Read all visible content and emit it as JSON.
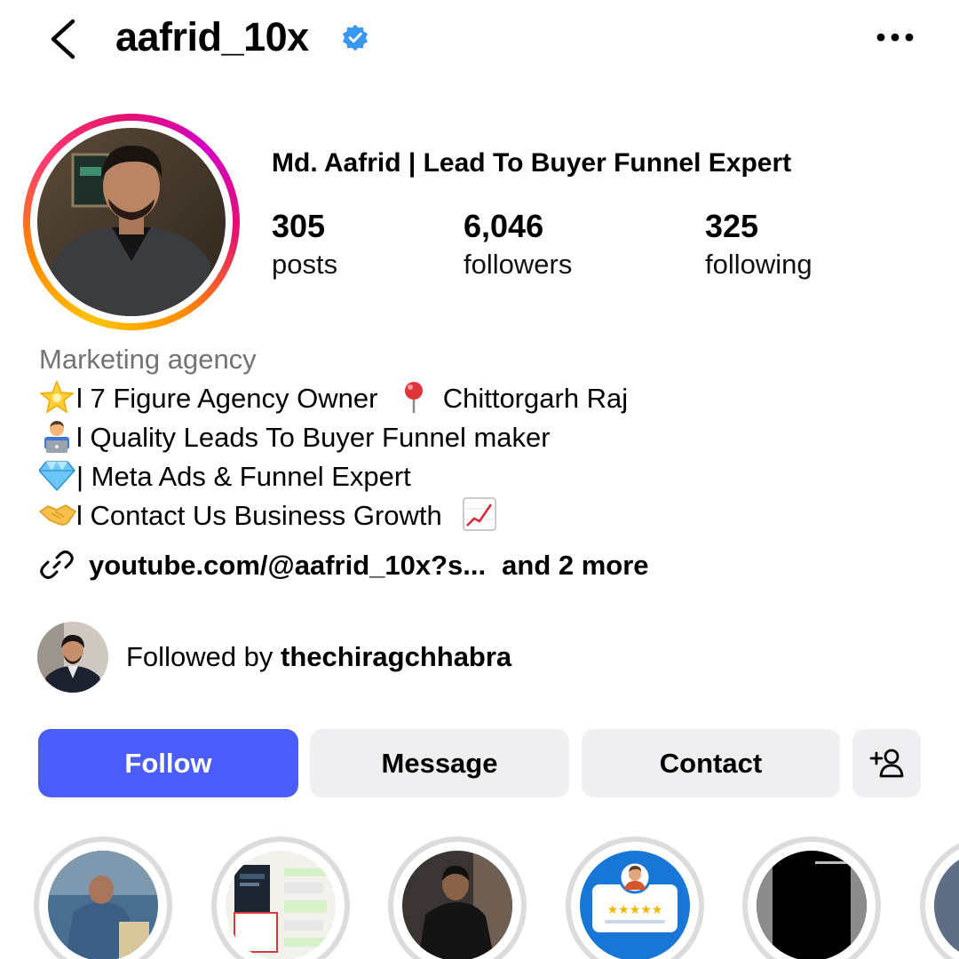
{
  "header": {
    "username": "aafrid_10x",
    "verified": true,
    "back_icon": "chevron-left-icon",
    "more_icon": "more-horizontal-icon"
  },
  "profile": {
    "display_name": "Md. Aafrid | Lead To Buyer Funnel Expert",
    "story_ring": true,
    "stats": {
      "posts": {
        "value": "305",
        "label": "posts"
      },
      "followers": {
        "value": "6,046",
        "label": "followers"
      },
      "following": {
        "value": "325",
        "label": "following"
      }
    }
  },
  "bio": {
    "category": "Marketing agency",
    "lines": [
      {
        "emoji": "glowing-star-icon",
        "text": "l 7 Figure Agency Owner",
        "trailing_emoji": "round-pushpin-icon",
        "trailing_text": "Chittorgarh Raj"
      },
      {
        "emoji": "technologist-icon",
        "text": "l Quality Leads To Buyer Funnel maker"
      },
      {
        "emoji": "gem-stone-icon",
        "text": "| Meta Ads & Funnel Expert"
      },
      {
        "emoji": "handshake-icon",
        "text": "l Contact Us Business Growth",
        "trailing_emoji": "chart-increasing-icon"
      }
    ],
    "link": {
      "icon": "link-icon",
      "text": "youtube.com/@aafrid_10x?s...",
      "more": "and 2 more"
    }
  },
  "followed_by": {
    "prefix": "Followed by",
    "name": "thechiragchhabra"
  },
  "actions": {
    "follow": "Follow",
    "message": "Message",
    "contact": "Contact",
    "add_user_icon": "add-person-icon"
  },
  "highlights_count_visible": 6,
  "colors": {
    "follow_button": "#4a5df9",
    "secondary_button": "#efeff1",
    "category_text": "#737373",
    "verified_badge": "#3897f0"
  }
}
